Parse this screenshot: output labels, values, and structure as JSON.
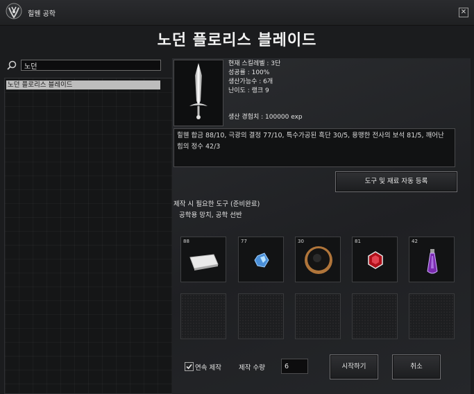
{
  "window": {
    "title": "힐웬 공학",
    "close_glyph": "✕"
  },
  "item": {
    "name": "노던 플로리스 블레이드",
    "skill_level": "현재 스킬레벨 : 3단",
    "success_rate": "성공률 : 100%",
    "craftable": "생산가능수 : 6개",
    "difficulty": "난이도 : 랭크 9",
    "exp": "생산 경험치 : 100000 exp"
  },
  "search": {
    "value": "노던"
  },
  "recipe_list": [
    {
      "label": "노던 플로리스 블레이드",
      "selected": true
    }
  ],
  "materials_text": "힐웬 합금 88/10, 극광의 결정 77/10, 특수가공된 흑단 30/5, 용맹한 전사의 보석 81/5, 깨어난 힘의 정수 42/3",
  "buttons": {
    "auto_register": "도구 및 재료 자동 등록",
    "start": "시작하기",
    "cancel": "취소"
  },
  "tools": {
    "title": "제작 시 필요한 도구 (준비완료)",
    "list": "공학용 망치, 공학 선반"
  },
  "material_slots": [
    {
      "count": "88",
      "icon": "alloy-ingot-icon"
    },
    {
      "count": "77",
      "icon": "crystal-icon"
    },
    {
      "count": "30",
      "icon": "ebony-disc-icon"
    },
    {
      "count": "81",
      "icon": "red-gem-icon"
    },
    {
      "count": "42",
      "icon": "potion-bottle-icon"
    }
  ],
  "options": {
    "continuous_label": "연속 제작",
    "continuous_checked": true,
    "quantity_label": "제작 수량",
    "quantity_value": "6"
  },
  "colors": {
    "background": "#1b1c1e",
    "selected_row": "#bdbdbd",
    "border": "#4a4a4c"
  }
}
